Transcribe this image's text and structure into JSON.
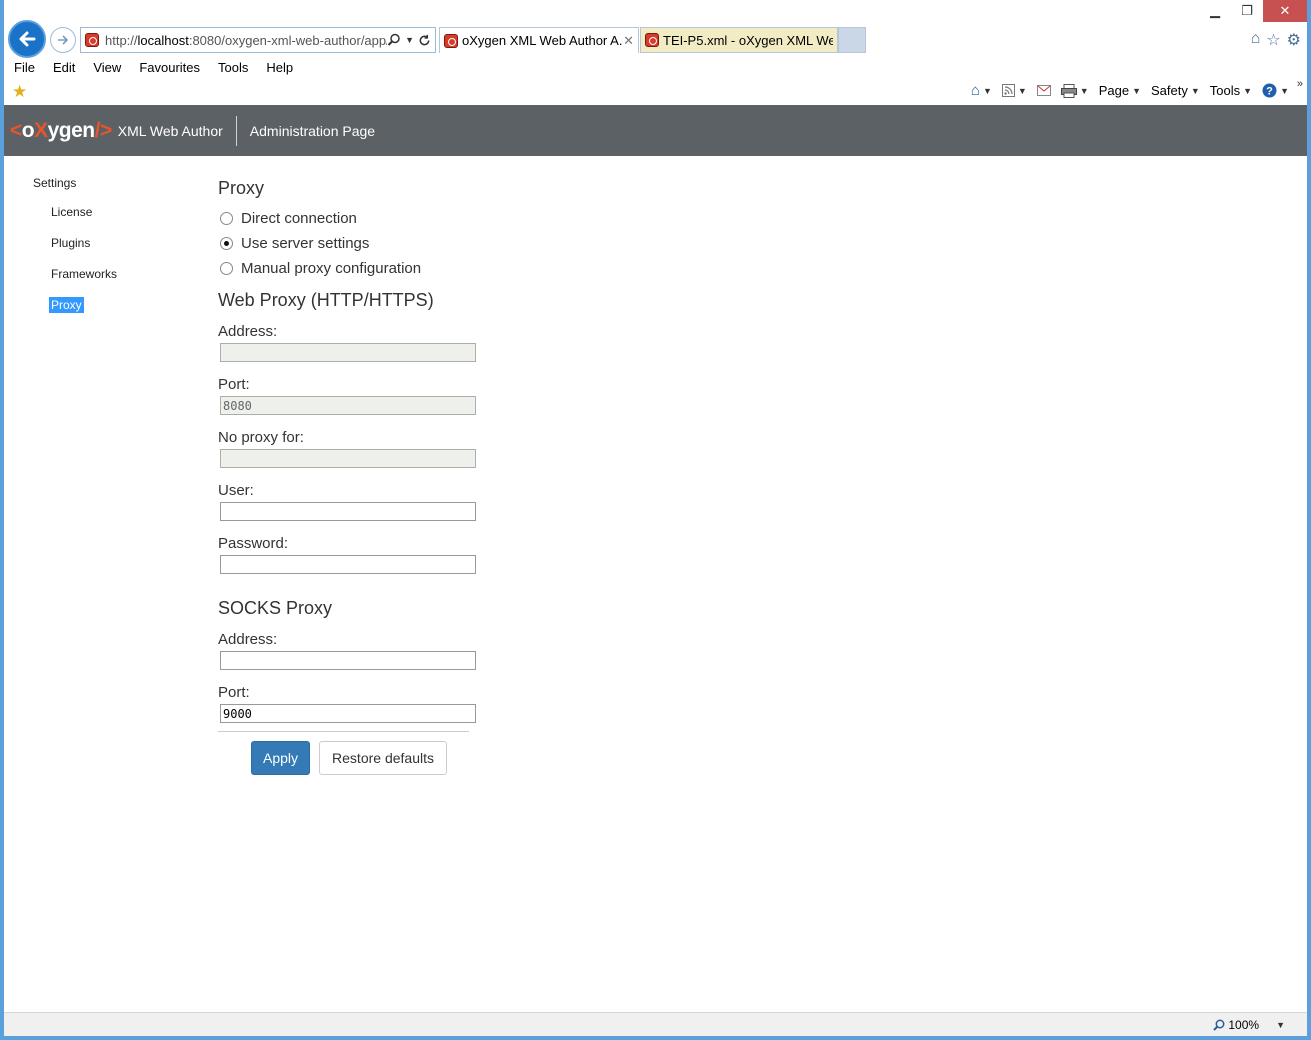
{
  "browser": {
    "url_prefix": "http://",
    "url_host": "localhost",
    "url_rest": ":8080/oxygen-xml-web-author/app/",
    "tabs": [
      {
        "label": "oXygen XML Web Author A..."
      },
      {
        "label": "TEI-P5.xml - oXygen XML Web..."
      }
    ],
    "menu": [
      "File",
      "Edit",
      "View",
      "Favourites",
      "Tools",
      "Help"
    ],
    "command_bar": {
      "page": "Page",
      "safety": "Safety",
      "tools": "Tools"
    },
    "zoom": "100%"
  },
  "header": {
    "logo_open": "<",
    "logo_o": "o",
    "logo_x": "X",
    "logo_rest": "ygen",
    "logo_close": "/>",
    "product": "XML Web Author",
    "page_title": "Administration Page"
  },
  "sidebar": {
    "root": "Settings",
    "items": [
      {
        "label": "License"
      },
      {
        "label": "Plugins"
      },
      {
        "label": "Frameworks"
      },
      {
        "label": "Proxy",
        "selected": true
      }
    ]
  },
  "proxy": {
    "title": "Proxy",
    "options": [
      {
        "label": "Direct connection",
        "checked": false
      },
      {
        "label": "Use server settings",
        "checked": true
      },
      {
        "label": "Manual proxy configuration",
        "checked": false
      }
    ]
  },
  "web_proxy": {
    "title": "Web Proxy (HTTP/HTTPS)",
    "address_label": "Address:",
    "address_value": "",
    "port_label": "Port:",
    "port_value": "8080",
    "no_proxy_label": "No proxy for:",
    "no_proxy_value": "",
    "user_label": "User:",
    "user_value": "",
    "password_label": "Password:",
    "password_value": ""
  },
  "socks_proxy": {
    "title": "SOCKS Proxy",
    "address_label": "Address:",
    "address_value": "",
    "port_label": "Port:",
    "port_value": "9000"
  },
  "actions": {
    "apply": "Apply",
    "restore": "Restore defaults"
  }
}
